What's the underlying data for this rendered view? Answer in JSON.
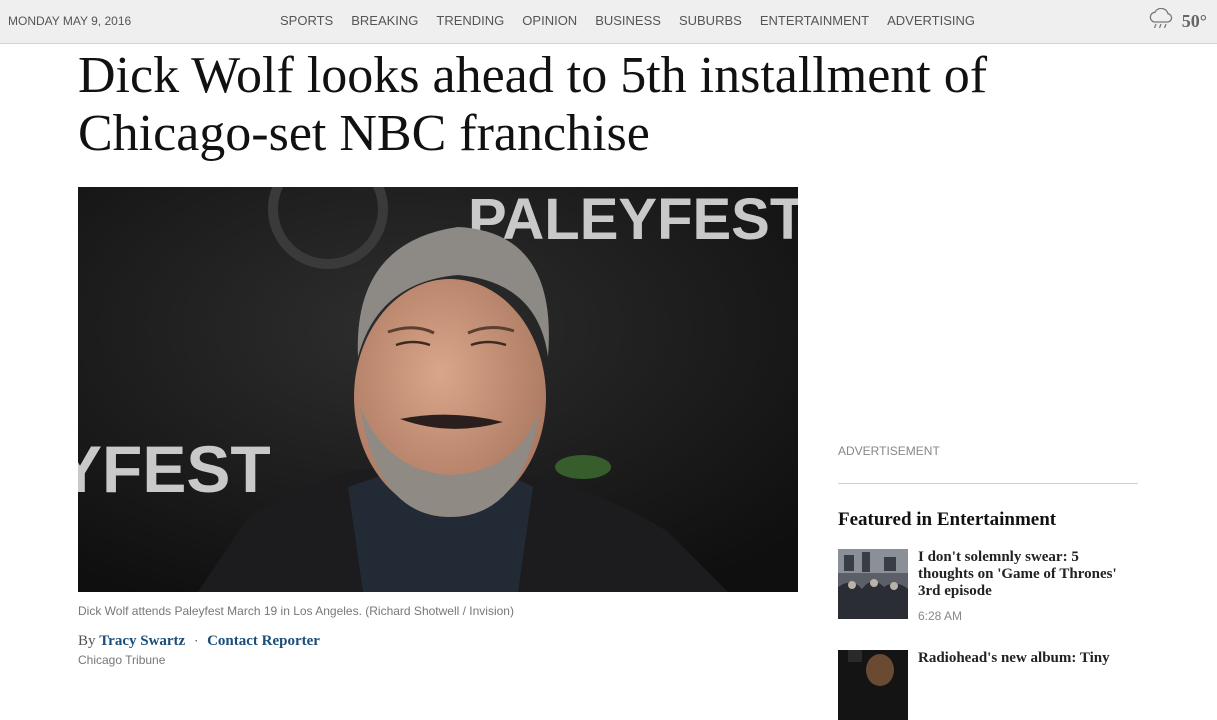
{
  "header": {
    "date": "MONDAY MAY 9, 2016",
    "nav": [
      "SPORTS",
      "BREAKING",
      "TRENDING",
      "OPINION",
      "BUSINESS",
      "SUBURBS",
      "ENTERTAINMENT",
      "ADVERTISING"
    ],
    "weather": {
      "icon": "rain-cloud-icon",
      "temp": "50°"
    }
  },
  "article": {
    "headline": "Dick Wolf looks ahead to 5th installment of Chicago-set NBC franchise",
    "photo": {
      "backdrop_text_top": "PALEYFEST",
      "backdrop_text_left": "YFEST"
    },
    "caption": "Dick Wolf attends Paleyfest March 19 in Los Angeles. (Richard Shotwell / Invision)",
    "byline": {
      "prefix": "By",
      "author": "Tracy Swartz",
      "separator": "·",
      "contact": "Contact Reporter"
    },
    "source": "Chicago Tribune"
  },
  "sidebar": {
    "ad_label": "ADVERTISEMENT",
    "featured_title": "Featured in Entertainment",
    "items": [
      {
        "title": "I don't solemnly swear: 5 thoughts on 'Game of Thrones' 3rd episode",
        "time": "6:28 AM"
      },
      {
        "title": "Radiohead's new album: Tiny"
      }
    ]
  },
  "colors": {
    "link": "#1a4d7a",
    "topbar_bg": "#efefef"
  }
}
